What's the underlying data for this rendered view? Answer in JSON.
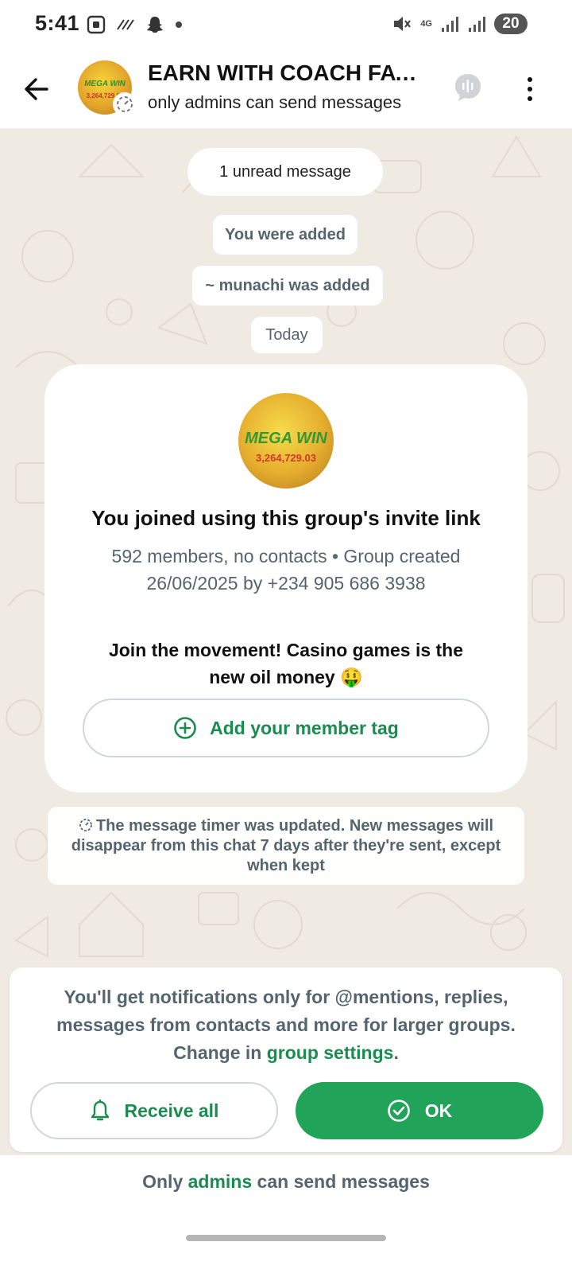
{
  "status_bar": {
    "time": "5:41",
    "network": "4G",
    "battery": "20"
  },
  "header": {
    "title": "EARN WITH COACH FAVE...",
    "subtitle": "only admins can send messages",
    "avatar_text": "MEGA WIN",
    "avatar_amount": "3,264,729.03",
    "icons": [
      "back-arrow-icon",
      "timer-icon",
      "voice-chat-icon",
      "more-vert-icon"
    ]
  },
  "chat": {
    "unread": "1 unread message",
    "system_messages": [
      "You were added",
      "~ munachi was added"
    ],
    "date_divider": "Today",
    "info_card": {
      "title": "You joined using this group's invite link",
      "meta": "592 members, no contacts • Group created 26/06/2025 by +234 905 686 3938",
      "description": "Join the movement! Casino games is the new oil money 🤑",
      "member_tag_button": "Add your member tag"
    },
    "timer_note": "The message timer was updated. New messages will disappear from this chat 7 days after they're sent, except when kept"
  },
  "notification_sheet": {
    "text_before": "You'll get notifications only for @mentions, replies, messages from contacts and more for larger groups. Change in ",
    "link": "group settings",
    "text_after": ".",
    "receive_all_button": "Receive all",
    "ok_button": "OK"
  },
  "footer": {
    "text_before": "Only ",
    "link": "admins",
    "text_after": " can send messages"
  },
  "colors": {
    "accent": "#1a8c4f",
    "ok_button": "#21a359",
    "chat_background": "#efeae2"
  }
}
